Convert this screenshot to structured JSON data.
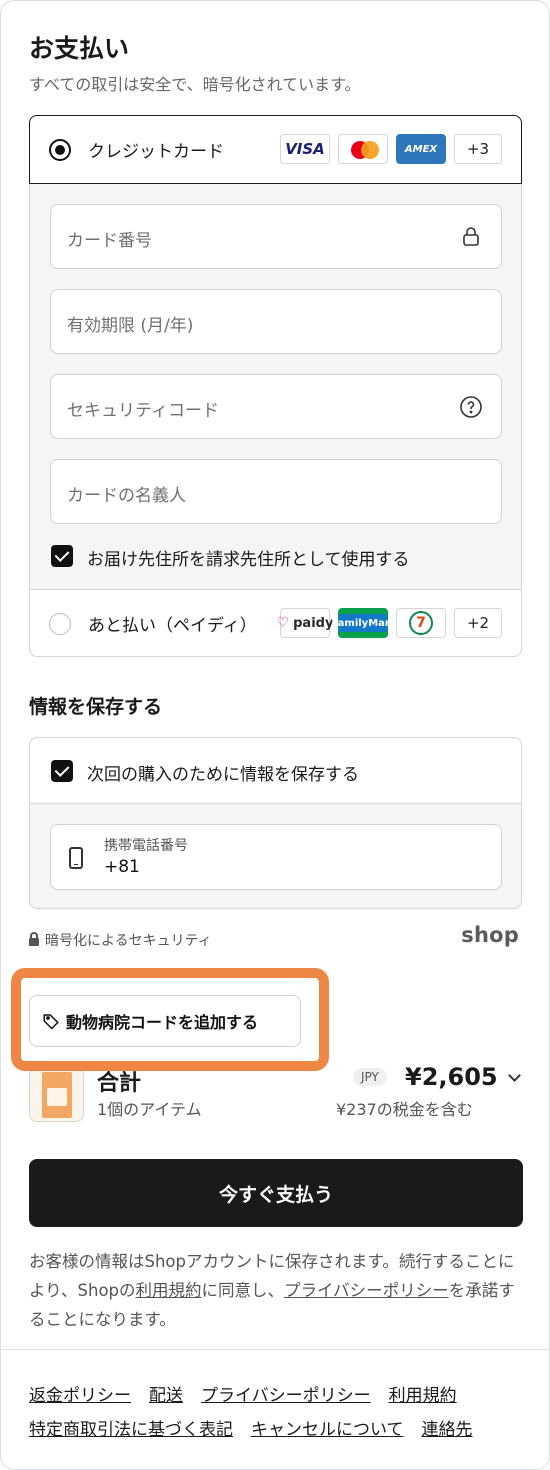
{
  "header": {
    "title": "お支払い",
    "subtitle": "すべての取引は安全で、暗号化されています。"
  },
  "payment": {
    "credit_card": {
      "label": "クレジットカード",
      "logos": [
        "VISA",
        "AMEX",
        "+3"
      ],
      "fields": {
        "card_number": "カード番号",
        "expiry": "有効期限 (月/年)",
        "security_code": "セキュリティコード",
        "card_name": "カードの名義人"
      },
      "billing_checkbox": "お届け先住所を請求先住所として使用する"
    },
    "paidy": {
      "label": "あと払い（ペイディ）",
      "logos": [
        "paidy",
        "FamilyMart",
        "7",
        "+2"
      ]
    }
  },
  "save_info": {
    "title": "情報を保存する",
    "checkbox": "次回の購入のために情報を保存する",
    "phone_label": "携帯電話番号",
    "phone_value": "+81"
  },
  "security": {
    "text": "暗号化によるセキュリティ",
    "shop_logo": "shop"
  },
  "vet_code_button": "動物病院コードを追加する",
  "summary": {
    "title": "合計",
    "items": "1個のアイテム",
    "currency": "JPY",
    "price": "¥2,605",
    "tax": "¥237の税金を含む"
  },
  "pay_button": "今すぐ支払う",
  "notice": {
    "p1": "お客様の情報はShopアカウントに保存されます。続行することにより、Shopの",
    "terms": "利用規約",
    "p2": "に同意し、",
    "privacy": "プライバシーポリシー",
    "p3": "を承諾することになります。"
  },
  "footer": {
    "row1": [
      "返金ポリシー",
      "配送",
      "プライバシーポリシー",
      "利用規約"
    ],
    "row2": [
      "特定商取引法に基づく表記",
      "キャンセルについて",
      "連絡先"
    ]
  },
  "colors": {
    "highlight": "#ee8743",
    "primary_button": "#1a1a1a"
  }
}
